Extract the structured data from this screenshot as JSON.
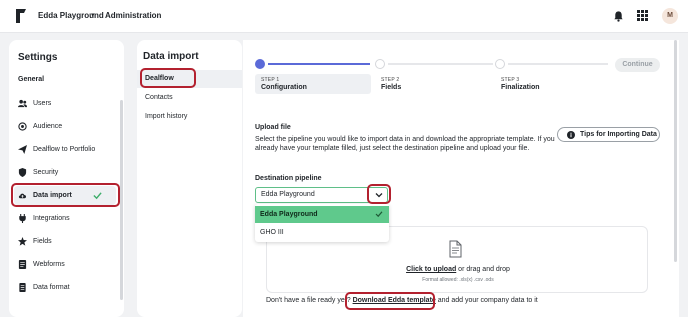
{
  "topbar": {
    "workspace": "Edda Playground",
    "section": "Administration",
    "avatar_initial": "M"
  },
  "settings": {
    "title": "Settings",
    "group_label": "General",
    "items": [
      {
        "label": "Users",
        "icon": "users-icon"
      },
      {
        "label": "Audience",
        "icon": "audience-icon"
      },
      {
        "label": "Dealflow to Portfolio",
        "icon": "send-icon"
      },
      {
        "label": "Security",
        "icon": "shield-icon"
      },
      {
        "label": "Data import",
        "icon": "cloud-upload-icon",
        "active": true
      },
      {
        "label": "Integrations",
        "icon": "plug-icon"
      },
      {
        "label": "Fields",
        "icon": "star-icon"
      },
      {
        "label": "Webforms",
        "icon": "form-icon"
      },
      {
        "label": "Data format",
        "icon": "document-icon"
      }
    ]
  },
  "data_import": {
    "title": "Data import",
    "items": [
      "Dealflow",
      "Contacts",
      "Import history"
    ]
  },
  "wizard": {
    "steps": [
      {
        "num": "STEP 1",
        "name": "Configuration"
      },
      {
        "num": "STEP 2",
        "name": "Fields"
      },
      {
        "num": "STEP 3",
        "name": "Finalization"
      }
    ],
    "continue_label": "Continue"
  },
  "upload": {
    "heading": "Upload file",
    "description": "Select the pipeline you would like to import data in and download the appropriate template. If you already have your template filled, just select the destination pipeline and upload your file.",
    "tips_label": "Tips for Importing Data",
    "destination_label": "Destination pipeline",
    "selected_value": "Edda Playground",
    "options": [
      "Edda Playground",
      "GHO III"
    ],
    "click_to_upload": "Click to upload",
    "drop_text_suffix": " or drag and drop",
    "format_text": "Format allowed: .xls(x) .csv .ods",
    "no_file_prefix": "Don't have a file ready yet?",
    "download_link": "Download Edda template",
    "no_file_suffix": " and add your company data to it"
  },
  "colors": {
    "accent": "#5b6ad8",
    "success": "#5fc98c",
    "highlight": "#b3212f"
  }
}
